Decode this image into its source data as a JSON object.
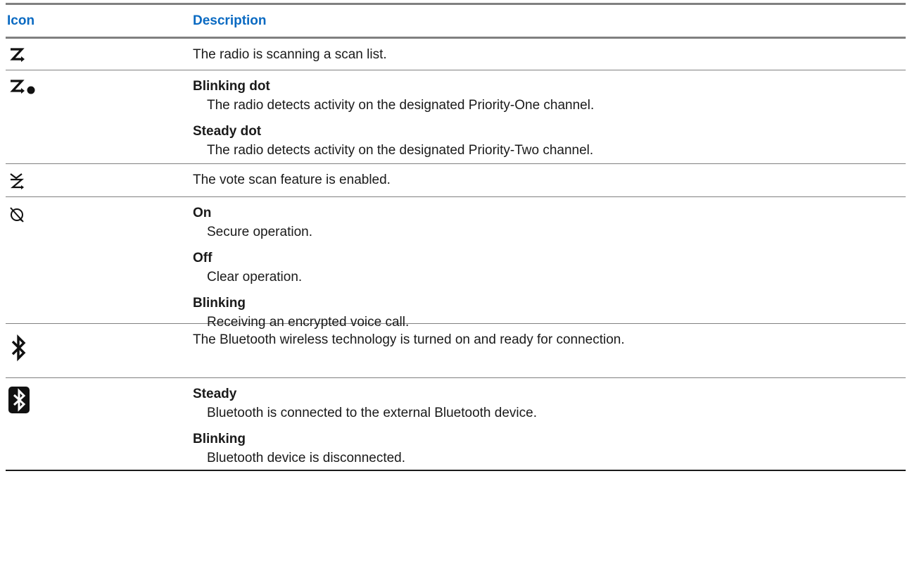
{
  "table": {
    "header": {
      "icon": "Icon",
      "description": "Description"
    },
    "rows": [
      {
        "icon": "scan-icon",
        "text": "The radio is scanning a scan list."
      },
      {
        "icon": "priority-scan-icon",
        "entries": [
          {
            "term": "Blinking dot",
            "def": "The radio detects activity on the designated Priority-One channel."
          },
          {
            "term": "Steady dot",
            "def": "The radio detects activity on the designated Priority-Two channel."
          }
        ]
      },
      {
        "icon": "vote-scan-icon",
        "text": "The vote scan feature is enabled."
      },
      {
        "icon": "secure-operation-icon",
        "entries": [
          {
            "term": "On",
            "def": "Secure operation."
          },
          {
            "term": "Off",
            "def": "Clear operation."
          },
          {
            "term": "Blinking",
            "def": "Receiving an encrypted voice call."
          }
        ]
      },
      {
        "icon": "bluetooth-icon",
        "text": "The Bluetooth wireless technology is turned on and ready for connection."
      },
      {
        "icon": "bluetooth-connected-icon",
        "entries": [
          {
            "term": "Steady",
            "def": "Bluetooth is connected to the external Bluetooth device."
          },
          {
            "term": "Blinking",
            "def": "Bluetooth device is disconnected."
          }
        ]
      }
    ]
  },
  "colors": {
    "header_text": "#0a6ac2",
    "rule": "#808080",
    "text": "#1a1a1a"
  }
}
